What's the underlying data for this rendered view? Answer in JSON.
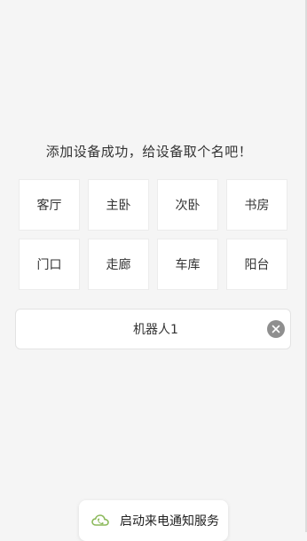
{
  "prompt": {
    "text": "添加设备成功，给设备取个名吧！"
  },
  "name_options": [
    {
      "label": "客厅"
    },
    {
      "label": "主卧"
    },
    {
      "label": "次卧"
    },
    {
      "label": "书房"
    },
    {
      "label": "门口"
    },
    {
      "label": "走廊"
    },
    {
      "label": "车库"
    },
    {
      "label": "阳台"
    }
  ],
  "name_field": {
    "value": "机器人1",
    "clear_icon": "close-circle-icon"
  },
  "toast": {
    "label": "启动来电通知服务",
    "icon": "cloud-phone-icon",
    "icon_color": "#8bb95a"
  },
  "colors": {
    "background": "#f5f5f5",
    "card": "#ffffff",
    "text": "#333333",
    "clear_button": "#8f8f8f"
  }
}
